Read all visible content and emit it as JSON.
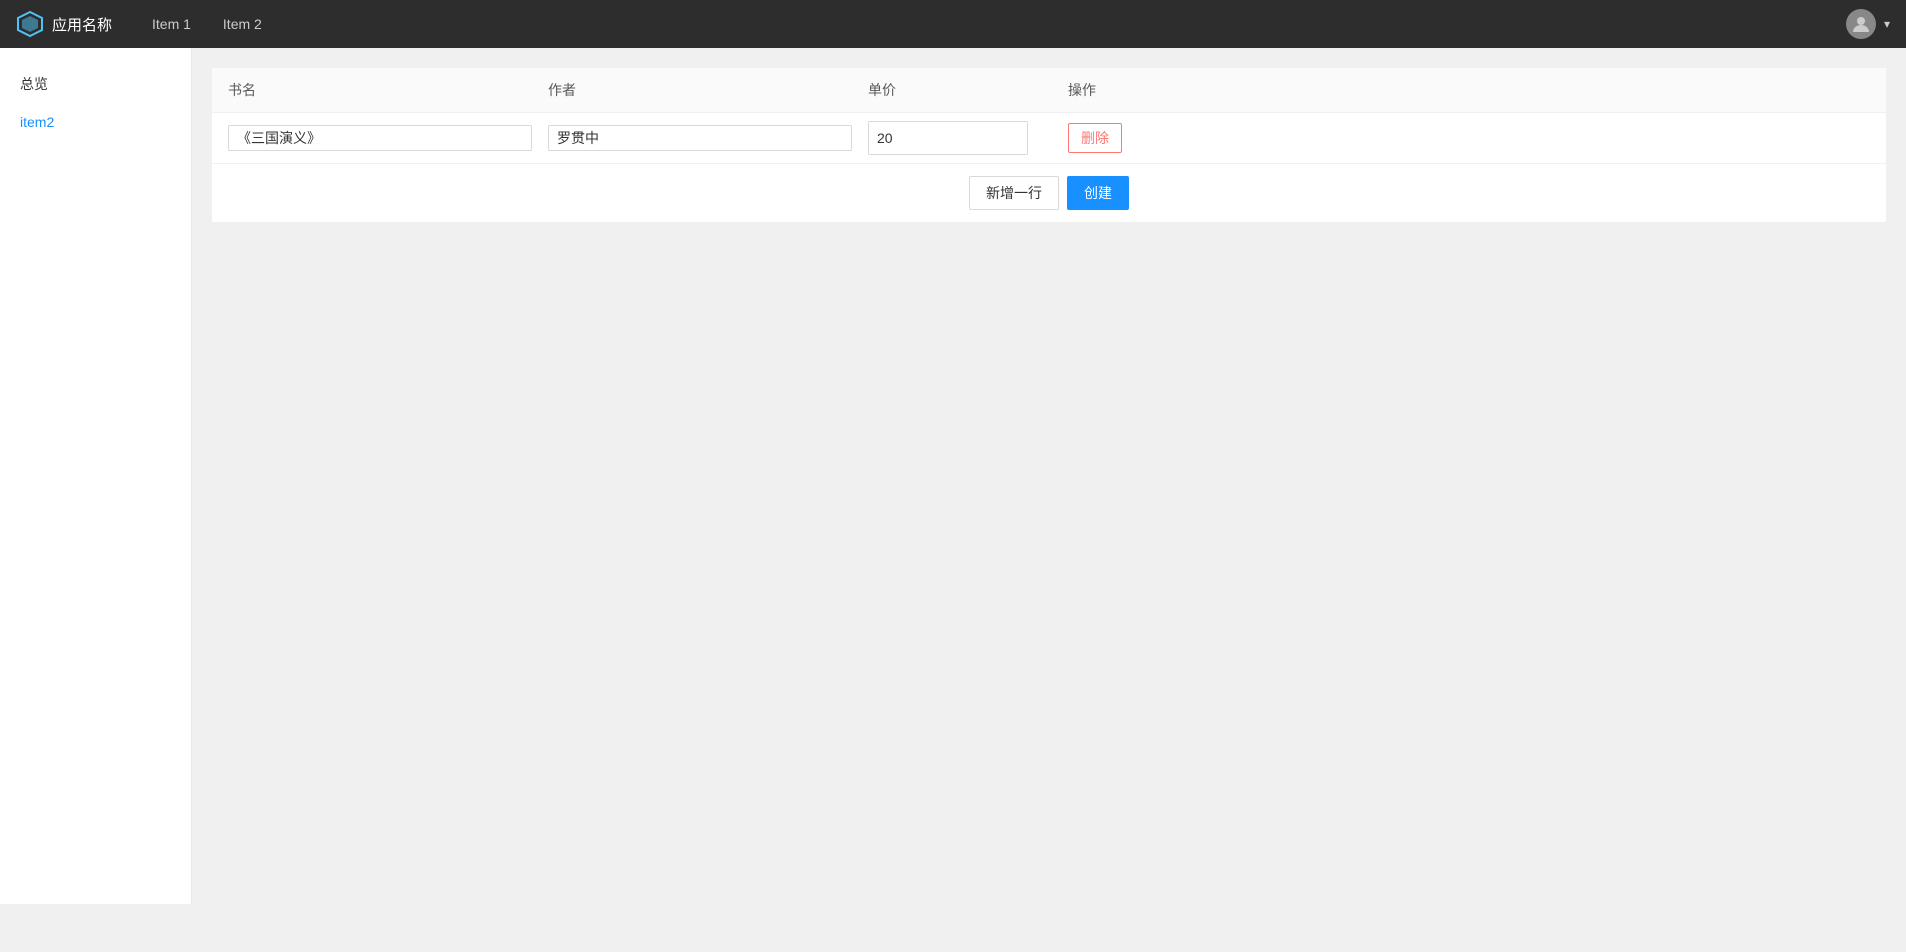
{
  "navbar": {
    "app_name": "应用名称",
    "menu_items": [
      {
        "label": "Item 1",
        "id": "item1"
      },
      {
        "label": "Item 2",
        "id": "item2"
      }
    ],
    "avatar_icon": "👤",
    "chevron": "▾"
  },
  "sidebar": {
    "items": [
      {
        "label": "总览",
        "id": "overview",
        "active": false
      },
      {
        "label": "item2",
        "id": "item2",
        "active": true
      }
    ]
  },
  "table": {
    "columns": {
      "book_name": "书名",
      "author": "作者",
      "price": "单价",
      "action": "操作"
    },
    "rows": [
      {
        "book_name": "《三国演义》",
        "author": "罗贯中",
        "price": "20"
      }
    ],
    "delete_label": "删除",
    "add_row_label": "新增一行",
    "create_label": "创建"
  }
}
